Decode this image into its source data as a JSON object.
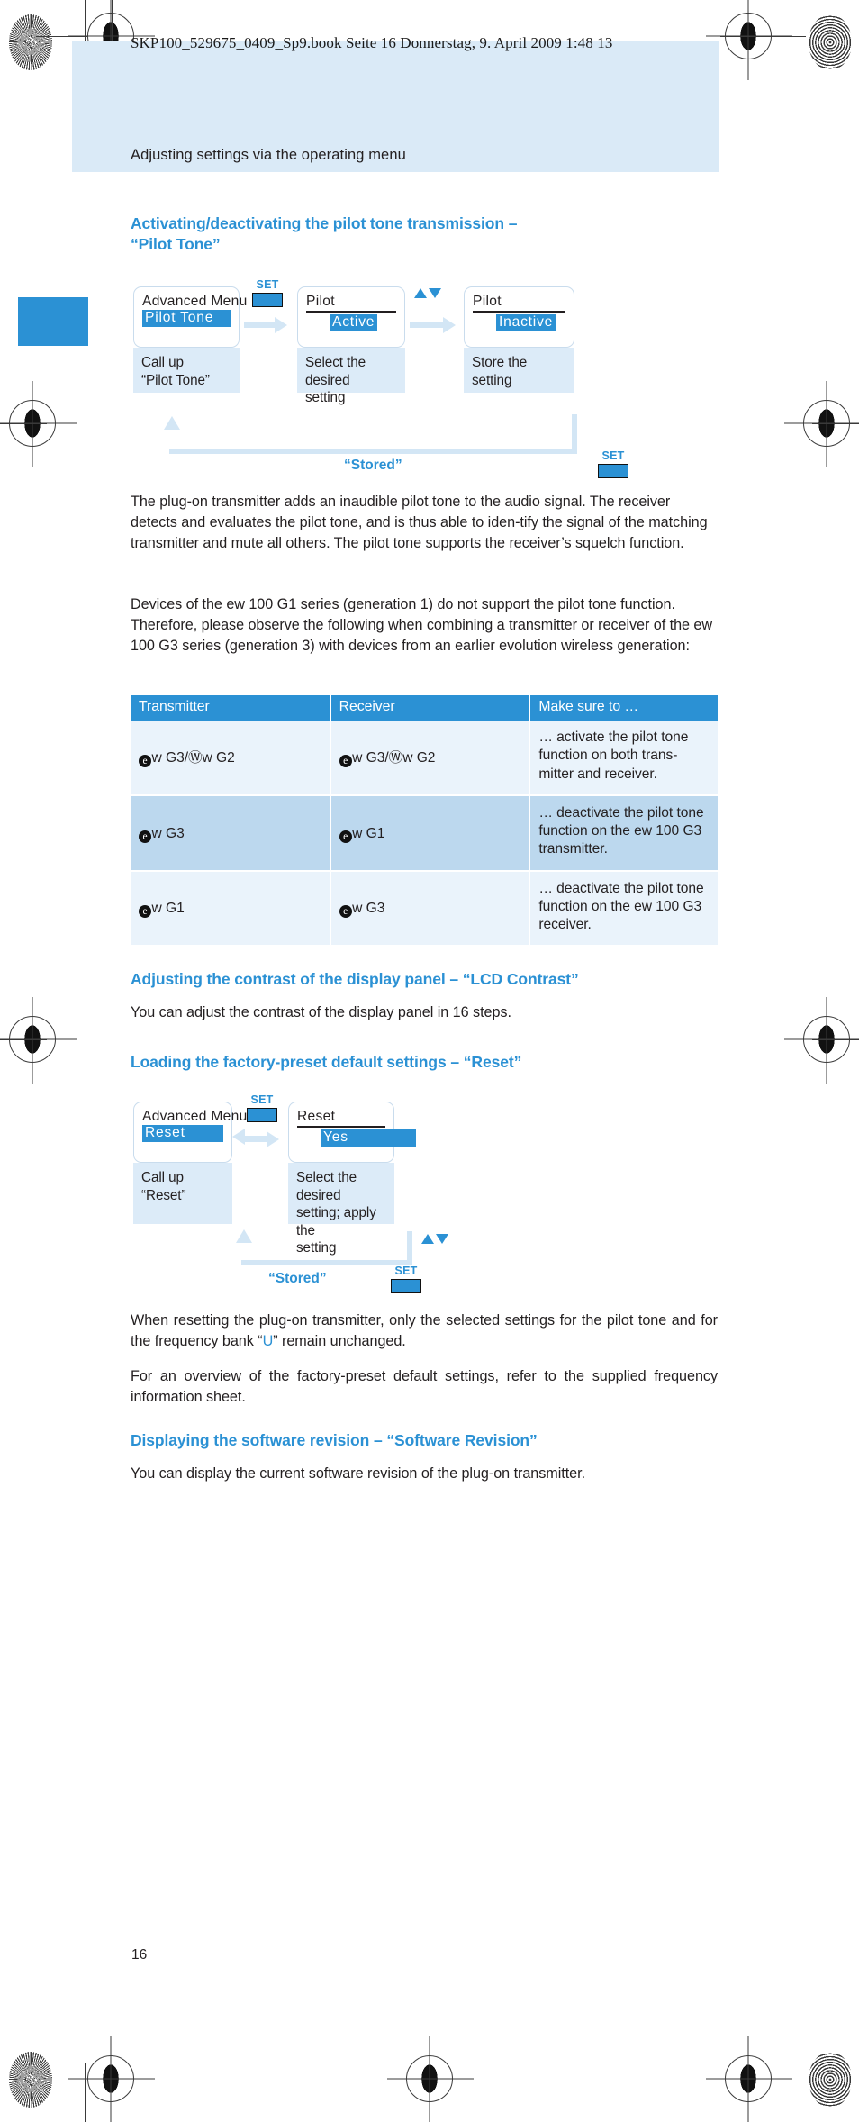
{
  "print_marks": {
    "filename_strip": "SKP100_529675_0409_Sp9.book  Seite 16  Donnerstag, 9. April 2009  1:48 13"
  },
  "running_head": "Adjusting settings via the operating menu",
  "page_number": "16",
  "colors": {
    "accent": "#2b91d4",
    "header_band": "#daeaf7",
    "caption_bg": "#dcebf8",
    "table_row_odd": "#eaf3fb",
    "table_row_even": "#bcd8ee",
    "arrow": "#d3e6f5",
    "text": "#231f20"
  },
  "sections": {
    "pilot_tone": {
      "heading_line1": "Activating/deactivating the pilot tone transmission –",
      "heading_line2": "“Pilot Tone”",
      "diagram": {
        "steps": [
          {
            "lcd_title": "Advanced  Menu",
            "lcd_selected": "Pilot Tone",
            "caption": "Call up\n“Pilot Tone”"
          },
          {
            "lcd_title": "Pilot",
            "lcd_selected": "Active",
            "caption": "Select the desired\nsetting"
          },
          {
            "lcd_title": "Pilot",
            "lcd_selected": "Inactive",
            "caption": "Store the setting"
          }
        ],
        "key_set_1": "SET",
        "key_updown": "▲▼",
        "key_set_2": "SET",
        "return_label": "“Stored”"
      },
      "paragraph_1": "The plug-on transmitter adds an inaudible pilot tone to the audio signal. The receiver detects and evaluates the pilot tone, and is thus able to iden-tify the signal of the matching transmitter and mute all others. The pilot tone supports the receiver’s squelch function.",
      "paragraph_2": "Devices of the ew 100 G1 series (generation 1) do not support the pilot tone function. Therefore, please observe the following when combining a transmitter or receiver of the ew 100 G3 series (generation 3) with devices from an earlier evolution wireless generation:",
      "table": {
        "headers": [
          "Transmitter",
          "Receiver",
          "Make sure to …"
        ],
        "rows": [
          {
            "transmitter": "w G3/Ⓦw G2",
            "receiver": "w G3/Ⓦw G2",
            "note": "… activate the pilot tone function on both trans-mitter and receiver."
          },
          {
            "transmitter": "w G3",
            "receiver": "w G1",
            "note": "… deactivate the pilot tone function on the ew 100 G3 transmitter."
          },
          {
            "transmitter": "w G1",
            "receiver": "w G3",
            "note": "… deactivate the pilot tone function on the ew 100 G3 receiver."
          }
        ]
      }
    },
    "lcd_contrast": {
      "heading": "Adjusting the contrast of the display panel – “LCD Contrast”",
      "paragraph": "You can adjust the contrast of the display panel in 16 steps."
    },
    "reset": {
      "heading": "Loading the factory-preset default settings – “Reset”",
      "diagram": {
        "steps": [
          {
            "lcd_title": "Advanced  Menu",
            "lcd_selected": "Reset",
            "caption": "Call up “Reset”"
          },
          {
            "lcd_title": "Reset",
            "lcd_selected": "Yes",
            "caption": "Select the desired\nsetting; apply the\nsetting"
          }
        ],
        "key_set_1": "SET",
        "key_updown": "▲▼",
        "key_set_2": "SET",
        "return_label": "“Stored”"
      },
      "paragraph_1_before": "When resetting the plug-on transmitter, only the selected settings for the pilot tone and for the frequency bank “",
      "paragraph_1_highlight": "U",
      "paragraph_1_after": "” remain unchanged.",
      "paragraph_2": "For an overview of the factory-preset default settings, refer to the supplied frequency information sheet."
    },
    "software_revision": {
      "heading": "Displaying the software revision – “Software Revision”",
      "paragraph": "You can display the current software revision of the plug-on transmitter."
    }
  }
}
